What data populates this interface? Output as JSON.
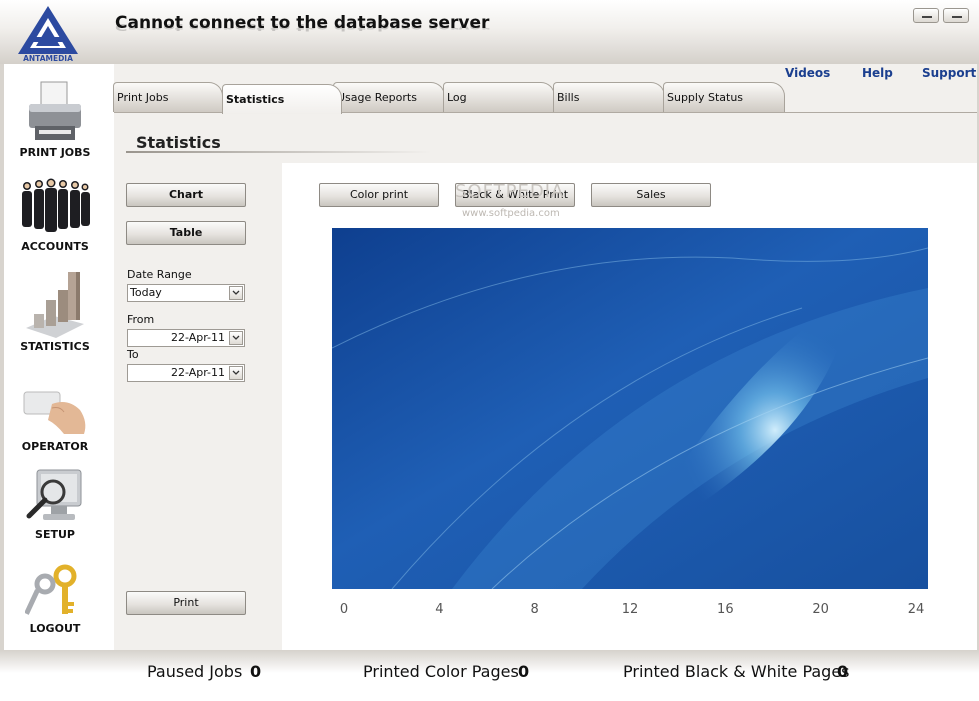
{
  "app": {
    "logo_text": "ANTAMEDIA",
    "title": "Cannot connect to the database server"
  },
  "window_controls": [
    "minimize-icon",
    "close-icon"
  ],
  "sidebar": {
    "items": [
      {
        "label": "PRINT JOBS",
        "icon": "printer-icon"
      },
      {
        "label": "ACCOUNTS",
        "icon": "people-icon"
      },
      {
        "label": "STATISTICS",
        "icon": "bar-chart-icon"
      },
      {
        "label": "OPERATOR",
        "icon": "card-hand-icon"
      },
      {
        "label": "SETUP",
        "icon": "monitor-magnifier-icon"
      },
      {
        "label": "LOGOUT",
        "icon": "keys-icon"
      }
    ]
  },
  "top_links": {
    "videos": "Videos",
    "help": "Help",
    "support": "Support"
  },
  "tabs": [
    {
      "label": "Print Jobs",
      "active": false
    },
    {
      "label": "Statistics",
      "active": true
    },
    {
      "label": "Usage Reports",
      "active": false
    },
    {
      "label": "Log",
      "active": false
    },
    {
      "label": "Bills",
      "active": false
    },
    {
      "label": "Supply Status",
      "active": false
    }
  ],
  "section": {
    "title": "Statistics"
  },
  "view_buttons": {
    "chart": "Chart",
    "table": "Table"
  },
  "filters": {
    "date_range_label": "Date Range",
    "date_range_value": "Today",
    "from_label": "From",
    "from_value": "22-Apr-11",
    "to_label": "To",
    "to_value": "22-Apr-11"
  },
  "print_button": "Print",
  "chart_buttons": {
    "color": "Color print",
    "bw": "Black & White Print",
    "sales": "Sales"
  },
  "watermark": {
    "main": "SOFTPEDIA",
    "sub": "www.softpedia.com"
  },
  "chart_data": {
    "type": "line",
    "x_ticks": [
      "0",
      "4",
      "8",
      "12",
      "16",
      "20",
      "24"
    ],
    "xlim": [
      0,
      24
    ],
    "series": [],
    "background": "#1f5fb5"
  },
  "status_bar": {
    "paused_jobs_label": "Paused Jobs",
    "paused_jobs_value": "0",
    "color_pages_label": "Printed Color Pages",
    "color_pages_value": "0",
    "bw_pages_label": "Printed Black & White Pages",
    "bw_pages_value": "0"
  },
  "colors": {
    "link": "#1b3f8f",
    "logo": "#2c4aa0"
  }
}
